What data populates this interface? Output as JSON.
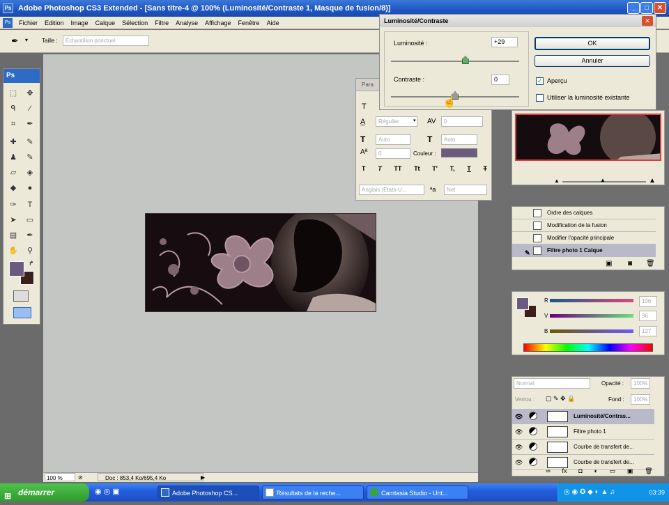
{
  "app": {
    "title": "Adobe Photoshop CS3 Extended - [Sans titre-4 @ 100% (Luminosité/Contraste 1, Masque de fusion/8)]",
    "ps_badge": "Ps"
  },
  "menu": [
    "Fichier",
    "Edition",
    "Image",
    "Calque",
    "Sélection",
    "Filtre",
    "Analyse",
    "Affichage",
    "Fenêtre",
    "Aide"
  ],
  "options_bar": {
    "label": "Taille :",
    "value": "Échantillon ponctuel"
  },
  "dialog": {
    "title": "Luminosité/Contraste",
    "brightness_label": "Luminosité :",
    "brightness_value": "+29",
    "brightness_level": 0.58,
    "contrast_label": "Contraste :",
    "contrast_value": "0",
    "contrast_level": 0.5,
    "ok": "OK",
    "cancel": "Annuler",
    "preview_label": "Aperçu",
    "preview_checked": true,
    "legacy_label": "Utiliser la luminosité existante",
    "legacy_checked": false
  },
  "char_panel": {
    "tab": "Para",
    "font_style": "Régulier",
    "auto": "Auto",
    "pt_a": "0",
    "color_label": "Couleur :",
    "color": "#6b5b7f",
    "lang": "Anglais (Etats-U...",
    "aa": "Net",
    "glyph_buttons": [
      "T",
      "T",
      "TT",
      "Tt",
      "T'",
      "T,",
      "T",
      "T"
    ]
  },
  "history": {
    "items": [
      "Ordre des calques",
      "Modification de la fusion",
      "Modifier l'opacité principale",
      "Filtre photo 1 Calque"
    ]
  },
  "color_panel": {
    "r_label": "R",
    "g_label": "V",
    "b_label": "B",
    "r_value": "106",
    "g_value": "96",
    "b_value": "127",
    "fg_color": "#6b5b7f",
    "bg_color": "#3a1f1c"
  },
  "layers": {
    "mode": "Normal",
    "opacity_label": "Opacité :",
    "opacity_value": "100%",
    "fill_label": "Fond :",
    "fill_value": "100%",
    "lock_label": "Verrou :",
    "items": [
      "Luminosité/Contras...",
      "Filtre photo 1",
      "Courbe de transfert de...",
      "Courbe de transfert de..."
    ]
  },
  "status": {
    "zoom": "100 %",
    "doc": "Doc : 853,4 Ko/695,4 Ko"
  },
  "taskbar": {
    "start": "démarrer",
    "tasks": [
      "Adobe Photoshop CS...",
      "Résultats de la reche...",
      "Camtasia Studio - Unt..."
    ],
    "clock": "03:39"
  },
  "colors": {
    "accent": "#2d6bc4",
    "workspace": "#c4c6c3"
  }
}
